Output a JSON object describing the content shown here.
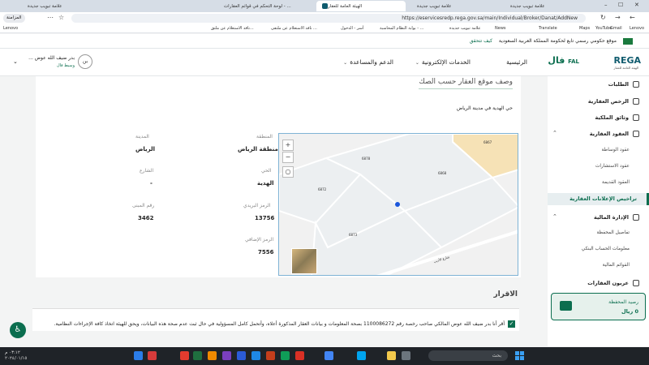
{
  "browser": {
    "tabs": [
      {
        "title": "علامة تبويب جديدة"
      },
      {
        "title": "لوحة التحكم في قوائم العقارات - ..."
      },
      {
        "title": "الهيئة العامة للعقار"
      },
      {
        "title": "علامة تبويب جديدة"
      },
      {
        "title": "علامة تبويب جديدة"
      }
    ],
    "url": "https://eservicesredp.rega.gov.sa/main/Individual/Broker/Danat/AddNew",
    "profile_label": "المزامنة",
    "bookmarks": [
      "Lenovo",
      "Gmail",
      "YouTube",
      "Maps",
      "Translate",
      "News",
      "علامة تبويب جديدة",
      "بوابة النظام المحاسبة - ...",
      "أسر - الدخول",
      "نافذ الاستعلام عن ملتقى ...",
      "نافذ الاستعلام عن ملتق...",
      "Lenovo"
    ]
  },
  "gov_banner": {
    "text": "موقع حكومي رسمي تابع لحكومة المملكة العربية السعودية",
    "how_link": "كيف تتحقق"
  },
  "header": {
    "brand": "REGA",
    "brand_sub": "الهيئة العامة للعقار",
    "fal": "فال",
    "fal_latin": "FAL",
    "nav": [
      "الرئيسية",
      "الخدمات الإلكترونية",
      "الدعم والمساعدة"
    ],
    "user": {
      "avatar": "بن",
      "name": "بدر ضيف الله عوض ...",
      "role": "وسيط فال"
    }
  },
  "sidebar": {
    "title": "الطلبات",
    "groups": [
      {
        "label": "الرخص العقارية"
      },
      {
        "label": "وثائق الملكية"
      },
      {
        "label": "العقود العقارية",
        "children": [
          "عقود الوساطة",
          "عقود الاستشارات",
          "العقود القديمة"
        ]
      },
      {
        "label": "تراخيص الإعلانات العقارية",
        "active": true
      },
      {
        "label": "الإدارة المالية",
        "children": [
          "تفاصيل المحفظة",
          "معلومات الحساب البنكي",
          "القوائم المالية"
        ]
      },
      {
        "label": "عربون العقارات"
      }
    ],
    "wallet": {
      "label": "رصيد المحفظة",
      "amount": "0 ريال"
    }
  },
  "main": {
    "section_title": "وصف موقع العقار حسب الصك",
    "description": "حي الهدية في مدينة الرياض",
    "fields": {
      "region_label": "المنطقة",
      "region_value": "منطقة الرياض",
      "city_label": "المدينة",
      "city_value": "الرياض",
      "district_label": "الحي",
      "district_value": "الهدية",
      "street_label": "الشارع",
      "street_value": "-",
      "postal_label": "الرمز البريدي",
      "postal_value": "13756",
      "building_label": "رقم المبنى",
      "building_value": "3462",
      "additional_label": "الرمز الإضافي",
      "additional_value": "7556"
    },
    "map": {
      "plots": [
        "6867",
        "6878",
        "6868",
        "6872",
        "6873"
      ],
      "street": "شارع الأديب"
    }
  },
  "declaration": {
    "title": "الاقرار",
    "text": "أقر أنا بدر ضيف الله عوض المالكي صاحب رخصة رقم 1100086272 بصحة المعلومات و بيانات العقار المذكورة أعلاه، وأتحمل كامل المسؤولية في حال ثبت عدم صحة هذه البيانات، ويحق للهيئة اتخاذ كافة الإجراءات النظامية."
  },
  "taskbar": {
    "search": "بحث",
    "time": "٠٣:١٢ م",
    "date": "٢٠٢٤/٠١/١٥"
  }
}
